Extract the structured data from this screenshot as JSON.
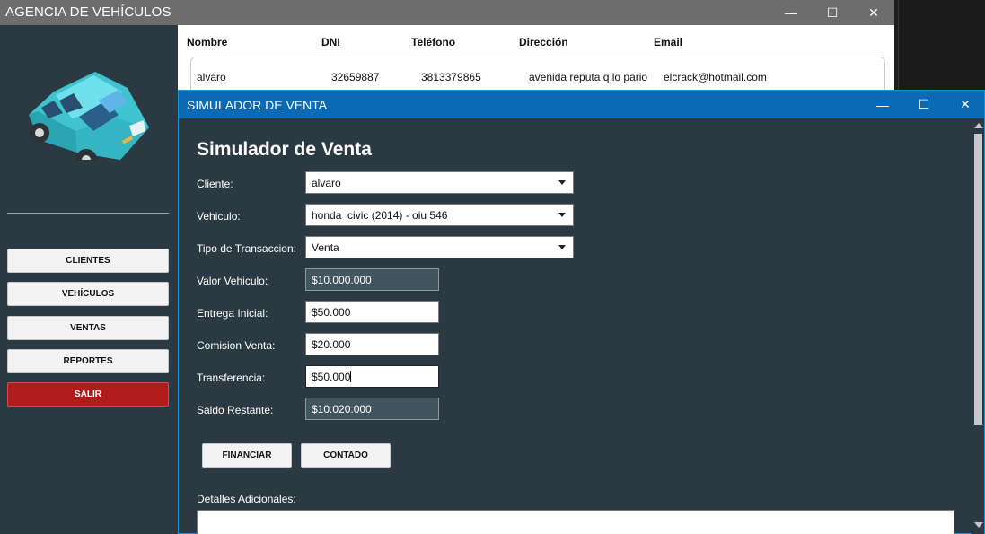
{
  "main_window": {
    "title": "AGENCIA DE VEHÍCULOS",
    "controls": {
      "minimize": "—",
      "maximize": "☐",
      "close": "✕"
    }
  },
  "sidebar": {
    "logo_icon": "car-icon",
    "buttons": [
      {
        "label": "CLIENTES"
      },
      {
        "label": "VEHÍCULOS"
      },
      {
        "label": "VENTAS"
      },
      {
        "label": "REPORTES"
      },
      {
        "label": "SALIR",
        "color": "#b01c1c"
      }
    ]
  },
  "clients_table": {
    "headers": [
      "Nombre",
      "DNI",
      "Teléfono",
      "Dirección",
      "Email"
    ],
    "rows": [
      [
        "alvaro",
        "32659887",
        "3813379865",
        "avenida reputa q lo pario",
        "elcrack@hotmail.com"
      ]
    ]
  },
  "simulator": {
    "window_title": "SIMULADOR DE VENTA",
    "heading": "Simulador de Venta",
    "controls": {
      "minimize": "—",
      "maximize": "☐",
      "close": "✕"
    },
    "fields": {
      "cliente": {
        "label": "Cliente:",
        "value": "alvaro"
      },
      "vehiculo": {
        "label": "Vehiculo:",
        "value": "honda  civic (2014) - oiu 546"
      },
      "tipo": {
        "label": "Tipo de Transaccion:",
        "value": "Venta"
      },
      "valor": {
        "label": "Valor Vehiculo:",
        "value": "$10.000.000"
      },
      "entrega": {
        "label": "Entrega Inicial:",
        "value": "$50.000"
      },
      "comision": {
        "label": "Comision Venta:",
        "value": "$20.000"
      },
      "transferencia": {
        "label": "Transferencia:",
        "value": "$50.000"
      },
      "saldo": {
        "label": "Saldo Restante:",
        "value": "$10.020.000"
      }
    },
    "buttons": {
      "financiar": "FINANCIAR",
      "contado": "CONTADO"
    },
    "detalles_label": "Detalles Adicionales:",
    "accent_color": "#0a6ab5"
  }
}
